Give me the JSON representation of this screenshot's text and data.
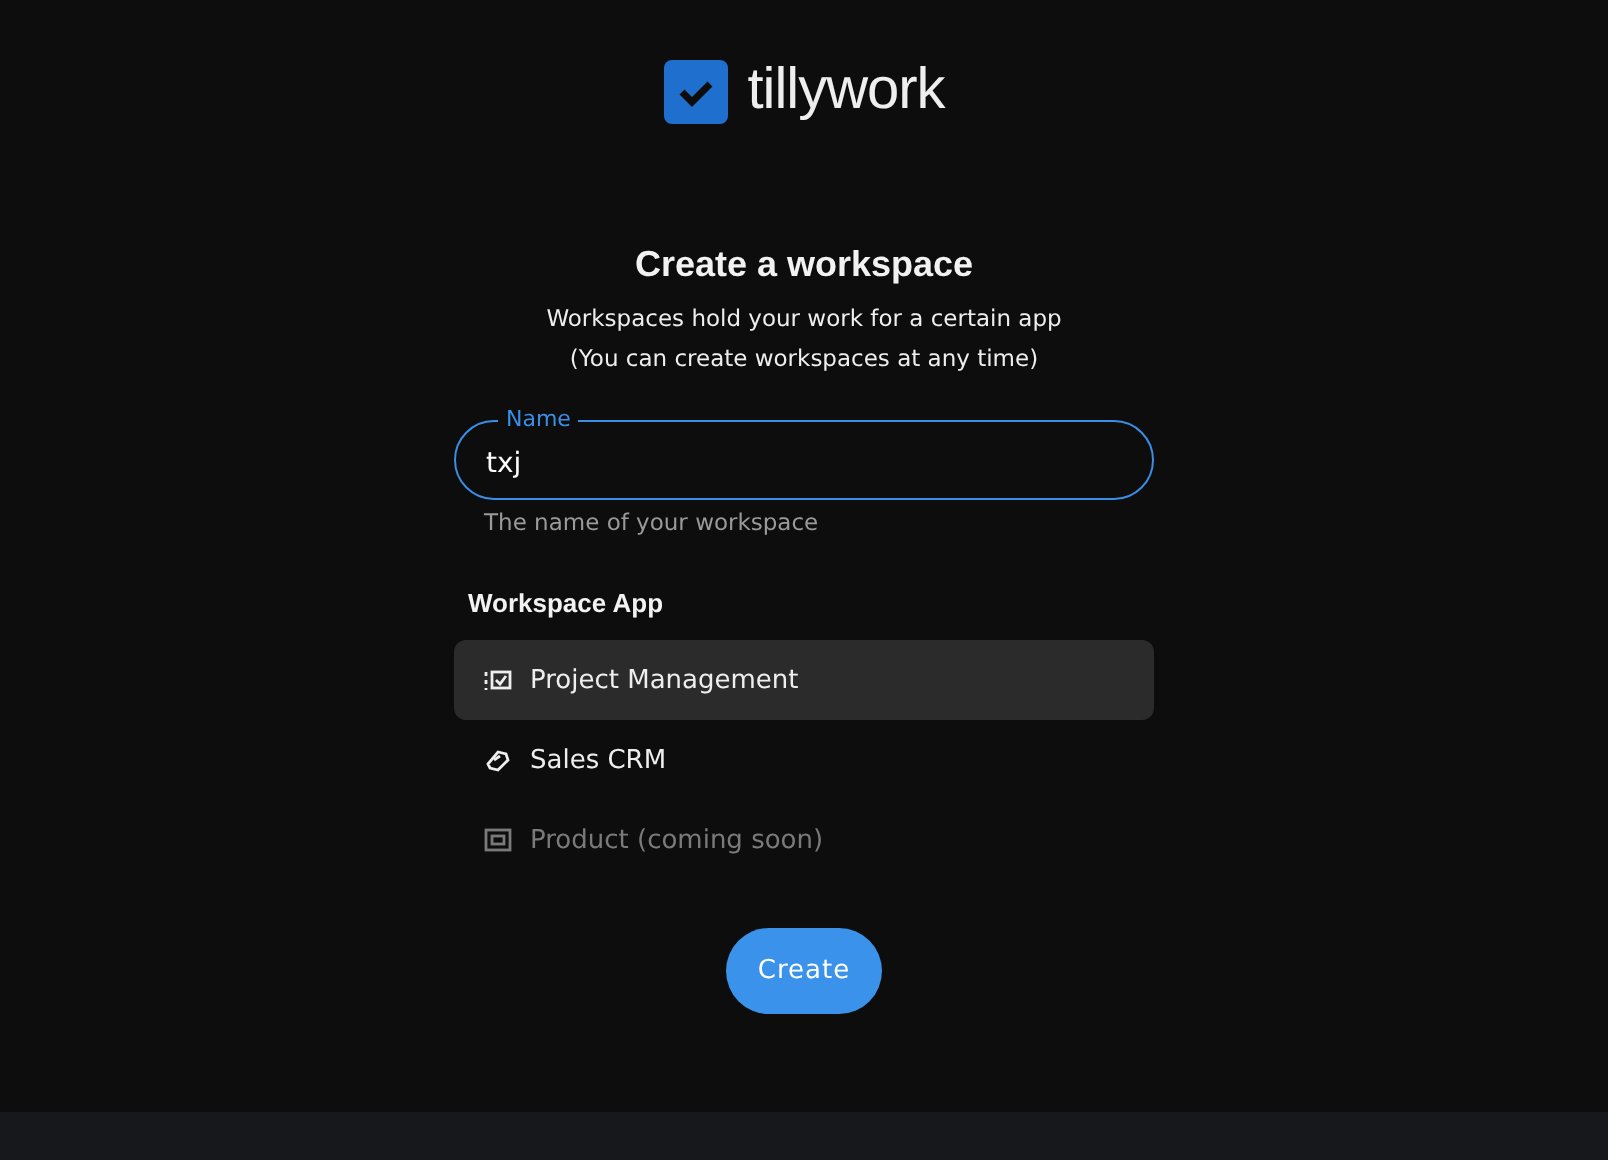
{
  "logo": {
    "name": "tillywork"
  },
  "heading": "Create a workspace",
  "subtitle_lines": [
    "Workspaces hold your work for a certain app",
    "(You can create workspaces at any time)"
  ],
  "name_field": {
    "label": "Name",
    "value": "txj",
    "hint": "The name of your workspace"
  },
  "app_section": {
    "title": "Workspace App",
    "apps": [
      {
        "label": "Project Management",
        "kind": "project",
        "selected": true,
        "disabled": false
      },
      {
        "label": "Sales CRM",
        "kind": "crm",
        "selected": false,
        "disabled": false
      },
      {
        "label": "Product (coming soon)",
        "kind": "product",
        "selected": false,
        "disabled": true
      }
    ]
  },
  "submit": "Create"
}
